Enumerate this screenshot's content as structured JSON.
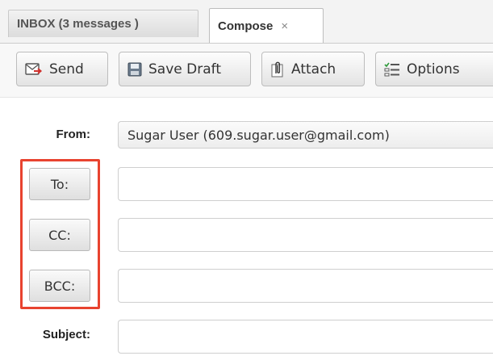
{
  "tabs": [
    {
      "label": "INBOX (3 messages )"
    },
    {
      "label": "Compose",
      "close_glyph": "×"
    }
  ],
  "toolbar": {
    "send_label": "Send",
    "save_draft_label": "Save Draft",
    "attach_label": "Attach",
    "options_label": "Options"
  },
  "form": {
    "from_label": "From:",
    "from_value": "Sugar User (609.sugar.user@gmail.com)",
    "to_button": "To:",
    "cc_button": "CC:",
    "bcc_button": "BCC:",
    "subject_label": "Subject:"
  },
  "icons": {
    "send": "send-icon",
    "save": "floppy-disk-icon",
    "attach": "paperclip-icon",
    "options": "checklist-icon"
  },
  "colors": {
    "highlight": "#e8432f"
  }
}
